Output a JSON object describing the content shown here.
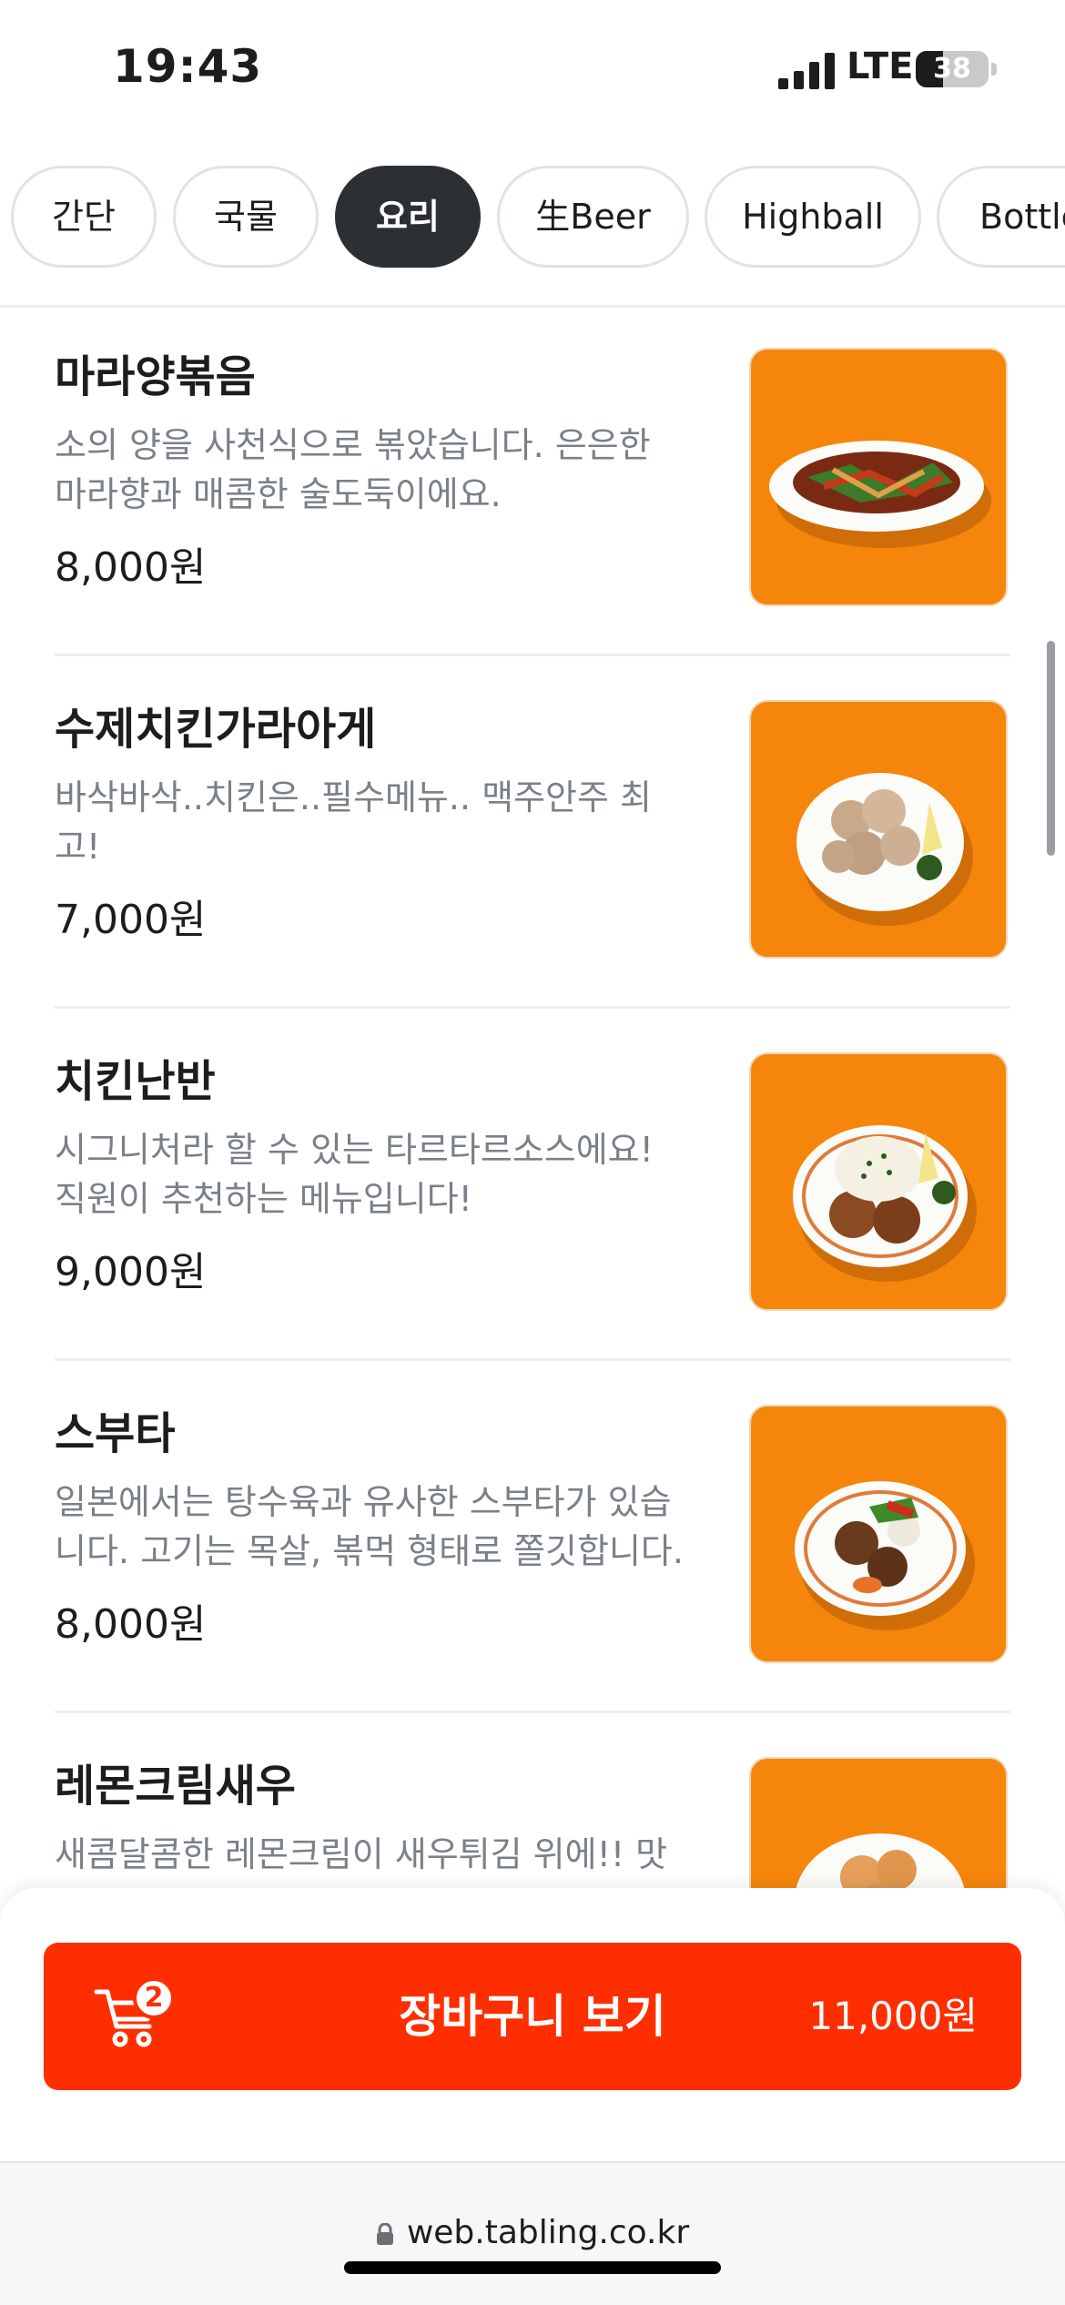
{
  "status_bar": {
    "time": "19:43",
    "network": "LTE",
    "battery": "38",
    "battery_level": 0.38
  },
  "categories": [
    {
      "label": "간단",
      "active": false
    },
    {
      "label": "국물",
      "active": false
    },
    {
      "label": "요리",
      "active": true
    },
    {
      "label": "生Beer",
      "active": false
    },
    {
      "label": "Highball",
      "active": false
    },
    {
      "label": "Bottle",
      "active": false
    }
  ],
  "menu_items": [
    {
      "name": "마라양볶음",
      "desc_line1": "소의 양을 사천식으로 볶았습니다. 은은한",
      "desc_line2": "마라향과 매콤한 술도둑이에요.",
      "price": "8,000원"
    },
    {
      "name": "수제치킨가라아게",
      "desc_line1": "바삭바삭..치킨은..필수메뉴.. 맥주안주 최",
      "desc_line2": "고!",
      "price": "7,000원"
    },
    {
      "name": "치킨난반",
      "desc_line1": "시그니처라 할 수 있는 타르타르소스에요!",
      "desc_line2": "직원이 추천하는 메뉴입니다!",
      "price": "9,000원"
    },
    {
      "name": "스부타",
      "desc_line1": "일본에서는 탕수육과 유사한 스부타가 있습",
      "desc_line2": "니다. 고기는 목살, 볶먹 형태로 쫄깃합니다.",
      "price": "8,000원"
    },
    {
      "name": "레몬크림새우",
      "desc_line1": "새콤달콤한 레몬크림이 새우튀김 위에!! 맛",
      "desc_line2": "",
      "price": ""
    }
  ],
  "cart": {
    "label": "장바구니 보기",
    "count": "2",
    "total": "11,000원"
  },
  "browser": {
    "url": "web.tabling.co.kr"
  },
  "colors": {
    "accent": "#ff2e00",
    "active_chip": "#2c3035",
    "thumb_bg": "#f5860b"
  }
}
